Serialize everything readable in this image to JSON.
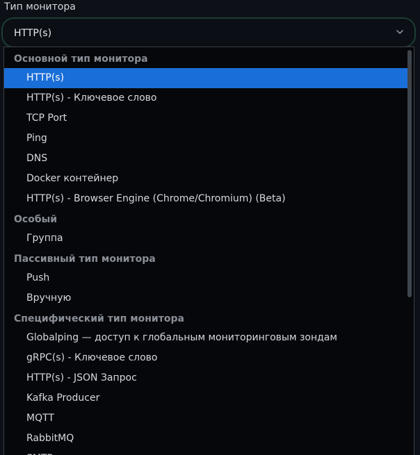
{
  "field": {
    "label": "Тип монитора",
    "selected_value": "HTTP(s)"
  },
  "icons": {
    "chevron": "chevron-down-icon"
  },
  "colors": {
    "selected_bg": "#1a6ed8",
    "field_border": "#1b3d33",
    "background": "#0d1117"
  },
  "dropdown": {
    "groups": [
      {
        "header": "Основной тип монитора",
        "options": [
          "HTTP(s)",
          "HTTP(s) - Ключевое слово",
          "TCP Port",
          "Ping",
          "DNS",
          "Docker контейнер",
          "HTTP(s) - Browser Engine (Chrome/Chromium) (Beta)"
        ]
      },
      {
        "header": "Особый",
        "options": [
          "Группа"
        ]
      },
      {
        "header": "Пассивный тип монитора",
        "options": [
          "Push",
          "Вручную"
        ]
      },
      {
        "header": "Специфический тип монитора",
        "options": [
          "Globalping — доступ к глобальным мониторинговым зондам",
          "gRPC(s) - Ключевое слово",
          "HTTP(s) - JSON Запрос",
          "Kafka Producer",
          "MQTT",
          "RabbitMQ",
          "SMTP"
        ]
      }
    ]
  }
}
